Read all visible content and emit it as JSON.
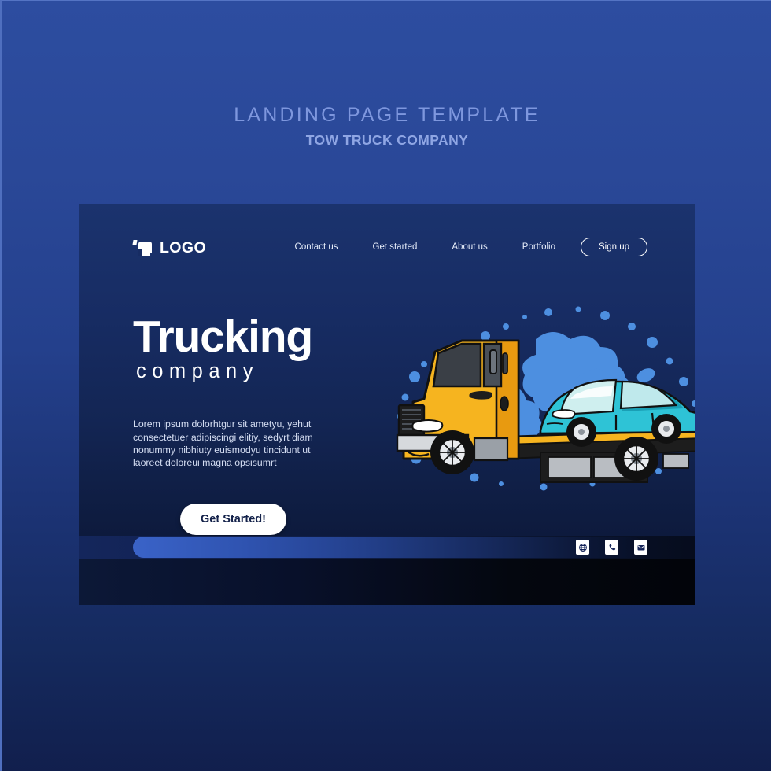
{
  "page": {
    "title_main": "LANDING  PAGE  TEMPLATE",
    "title_sub": "TOW TRUCK COMPANY",
    "bg_color": "#2a4898",
    "card_color": "#172c63"
  },
  "nav": {
    "logo_text": "LOGO",
    "links": [
      {
        "label": "Contact us"
      },
      {
        "label": "Get started"
      },
      {
        "label": "About us"
      },
      {
        "label": "Portfolio"
      }
    ],
    "signup_label": "Sign up"
  },
  "hero": {
    "heading_line1": "Trucking",
    "heading_line2": "company",
    "paragraph": "Lorem ipsum dolorhtgur sit ametyu, yehut consectetuer adipiscingi elitiy, sedyrt diam nonummy nibhiuty euismodyu tincidunt ut laoreet doloreui magna opsisumrt",
    "cta_label": "Get Started!"
  },
  "illustration": {
    "description": "Yellow flatbed tow truck carrying a cyan hatchback car over blue paint splatter",
    "truck_color": "#f6b41f",
    "truck_shadow_color": "#e08a12",
    "car_color": "#2ec3d6",
    "car_dark_color": "#1a9fb5",
    "splatter_color": "#4d8fe0",
    "bed_color": "#1b1b1b"
  },
  "footer": {
    "icons": [
      {
        "name": "globe-icon",
        "glyph": "globe"
      },
      {
        "name": "phone-icon",
        "glyph": "phone"
      },
      {
        "name": "email-icon",
        "glyph": "email"
      }
    ],
    "progress_value": 100
  }
}
